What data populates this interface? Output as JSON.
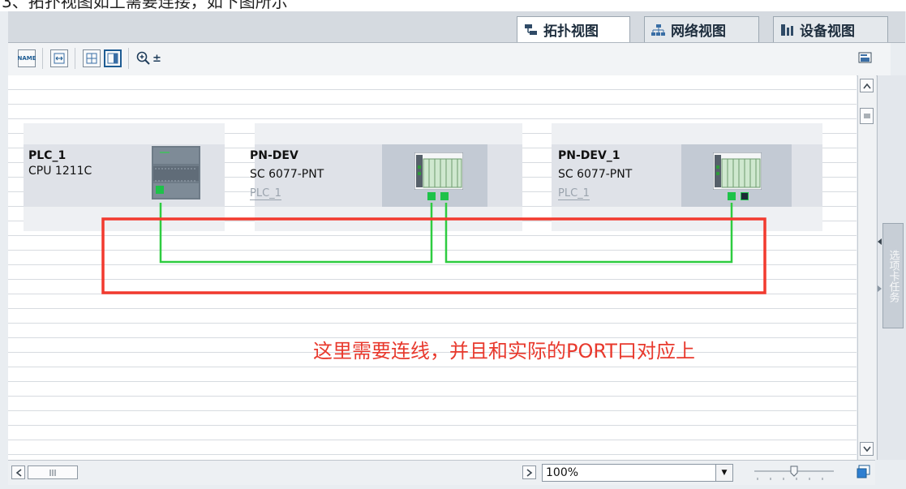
{
  "caption": "3、拓扑视图如上需要连接，如下图所示",
  "tabs": [
    {
      "label": "拓扑视图",
      "icon": "topology-view-icon",
      "active": true
    },
    {
      "label": "网络视图",
      "icon": "network-view-icon",
      "active": false
    },
    {
      "label": "设备视图",
      "icon": "device-view-icon",
      "active": false
    }
  ],
  "toolbar": {
    "name_icon_label": "NAME",
    "zoom_arrow": "±"
  },
  "devices": [
    {
      "name": "PLC_1",
      "type": "CPU 1211C",
      "link": ""
    },
    {
      "name": "PN-DEV",
      "type": "SC 6077-PNT",
      "link": "PLC_1"
    },
    {
      "name": "PN-DEV_1",
      "type": "SC 6077-PNT",
      "link": "PLC_1"
    }
  ],
  "annotation": "这里需要连线，并且和实际的PORT口对应上",
  "side_panel_label": "选项卡任务",
  "zoom": {
    "value": "100%"
  },
  "colors": {
    "link_line": "#2ecc40",
    "highlight_box": "#f23a2f",
    "annotation": "#e8392d",
    "port_active": "#1ec24a"
  }
}
